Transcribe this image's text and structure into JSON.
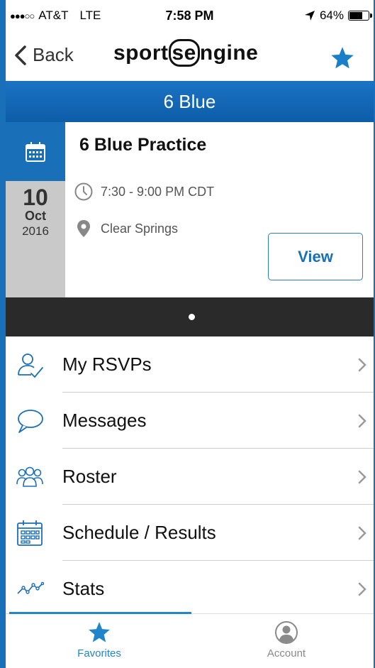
{
  "status_bar": {
    "signal": "●●●○○",
    "carrier": "AT&T",
    "network": "LTE",
    "time": "7:58 PM",
    "battery": "64%"
  },
  "nav": {
    "back_label": "Back",
    "logo_left": "sport",
    "logo_mid": "se",
    "logo_right": "ngine"
  },
  "team": {
    "name": "6 Blue"
  },
  "event": {
    "title": "6 Blue Practice",
    "day": "10",
    "month": "Oct",
    "year": "2016",
    "time": "7:30 - 9:00 PM CDT",
    "location": "Clear Springs",
    "view_label": "View"
  },
  "menu": {
    "items": [
      {
        "label": "My RSVPs",
        "icon": "rsvp-person-check-icon"
      },
      {
        "label": "Messages",
        "icon": "speech-bubble-icon"
      },
      {
        "label": "Roster",
        "icon": "group-people-icon"
      },
      {
        "label": "Schedule / Results",
        "icon": "calendar-grid-icon"
      },
      {
        "label": "Stats",
        "icon": "line-graph-icon"
      }
    ]
  },
  "tabs": {
    "favorites": "Favorites",
    "account": "Account"
  },
  "colors": {
    "brand_blue": "#1a6fb9",
    "tab_active": "#2086c9",
    "date_bg": "#c9c9c9",
    "pager_bg": "#2a2a2a"
  }
}
